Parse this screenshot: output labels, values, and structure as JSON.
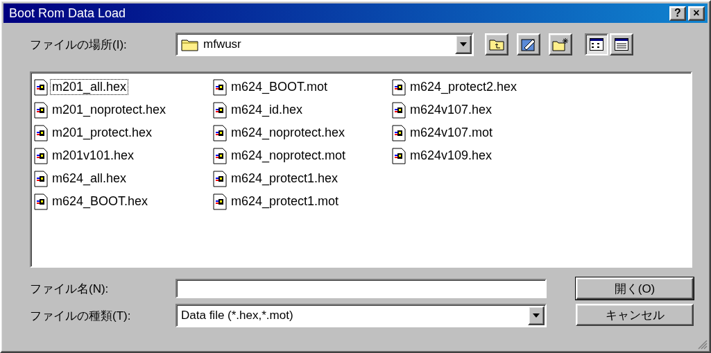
{
  "window": {
    "title": "Boot Rom Data Load",
    "title_buttons": [
      "?",
      "×"
    ]
  },
  "location": {
    "label": "ファイルの場所(I):",
    "value": "mfwusr"
  },
  "view_buttons": [
    {
      "selected": true
    },
    {
      "selected": false
    }
  ],
  "files": [
    {
      "name": "m201_all.hex",
      "focused": true
    },
    {
      "name": "m201_noprotect.hex",
      "focused": false
    },
    {
      "name": "m201_protect.hex",
      "focused": false
    },
    {
      "name": "m201v101.hex",
      "focused": false
    },
    {
      "name": "m624_all.hex",
      "focused": false
    },
    {
      "name": "m624_BOOT.hex",
      "focused": false
    },
    {
      "name": "m624_BOOT.mot",
      "focused": false
    },
    {
      "name": "m624_id.hex",
      "focused": false
    },
    {
      "name": "m624_noprotect.hex",
      "focused": false
    },
    {
      "name": "m624_noprotect.mot",
      "focused": false
    },
    {
      "name": "m624_protect1.hex",
      "focused": false
    },
    {
      "name": "m624_protect1.mot",
      "focused": false
    },
    {
      "name": "m624_protect2.hex",
      "focused": false
    },
    {
      "name": "m624v107.hex",
      "focused": false
    },
    {
      "name": "m624v107.mot",
      "focused": false
    },
    {
      "name": "m624v109.hex",
      "focused": false
    }
  ],
  "filename": {
    "label": "ファイル名(N):"
  },
  "filetype": {
    "label": "ファイルの種類(T):",
    "value": "Data file (*.hex,*.mot)"
  },
  "buttons": [
    "開く(O)",
    "キャンセル"
  ]
}
